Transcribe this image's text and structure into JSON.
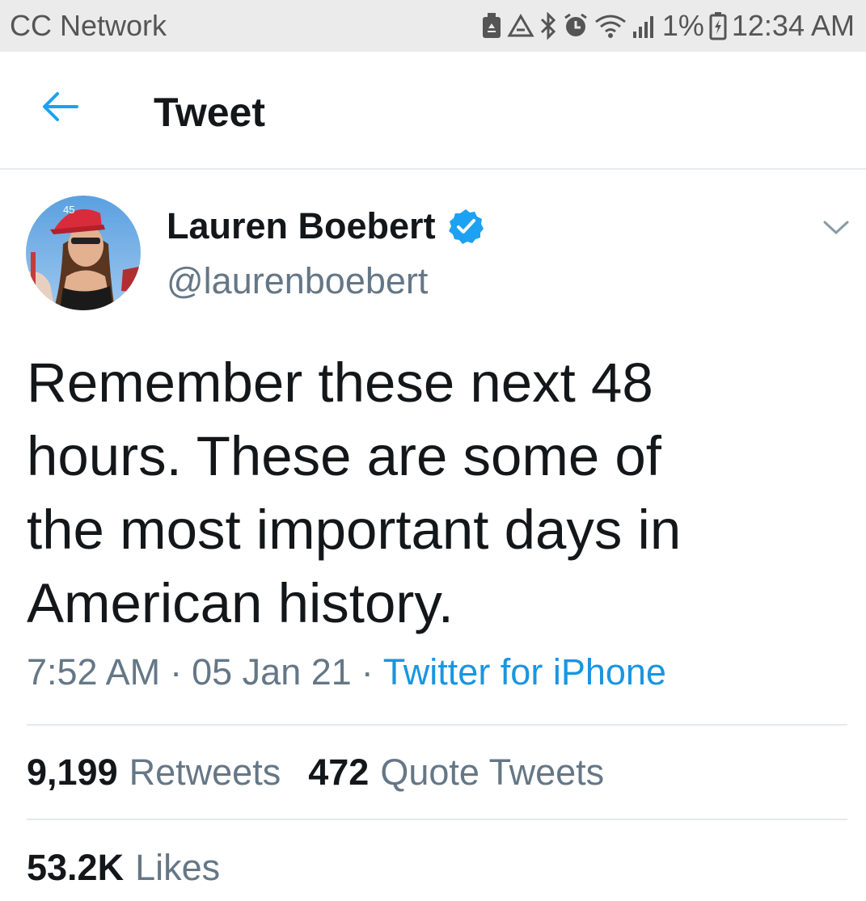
{
  "status_bar": {
    "carrier": "CC Network",
    "battery": "1%",
    "time": "12:34 AM",
    "icons": [
      "recycle-box-icon",
      "recycle-icon",
      "bluetooth-icon",
      "alarm-icon",
      "wifi-icon",
      "signal-icon",
      "battery-charging-icon"
    ]
  },
  "header": {
    "title": "Tweet",
    "back_icon": "back-arrow-icon"
  },
  "tweet": {
    "author_name": "Lauren Boebert",
    "author_handle": "@laurenboebert",
    "verified": true,
    "text": "Remember these next 48\nhours. These are some of\nthe most important days in\nAmerican history.",
    "time": "7:52 AM",
    "date": "05 Jan 21",
    "separator": "·",
    "source": "Twitter for iPhone",
    "retweets_count": "9,199",
    "retweets_label": "Retweets",
    "quotes_count": "472",
    "quotes_label": "Quote Tweets",
    "likes_count": "53.2K",
    "likes_label": "Likes"
  },
  "colors": {
    "accent": "#1da1f2",
    "link": "#1b95e0",
    "secondary_text": "#657786",
    "status_bar_bg": "#ebebeb"
  }
}
